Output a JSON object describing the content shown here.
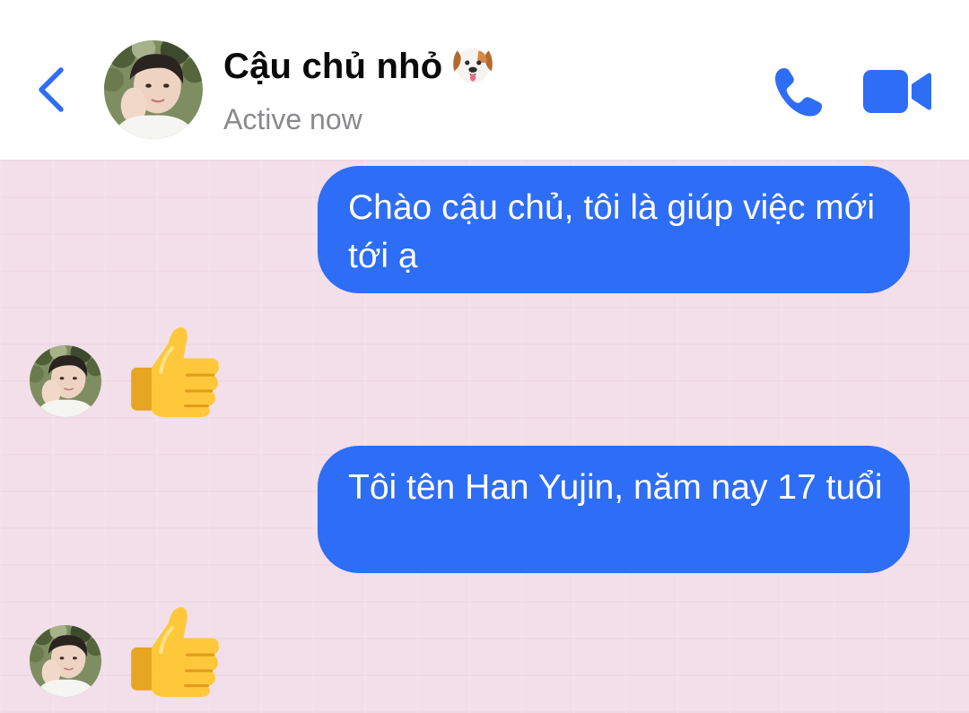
{
  "header": {
    "contact_name": "Cậu chủ nhỏ",
    "name_emoji": "dog-face-emoji",
    "status": "Active now",
    "icons": {
      "back": "chevron-left-icon",
      "call": "phone-icon",
      "video": "video-camera-icon"
    },
    "accent_color": "#2e6df6"
  },
  "messages": [
    {
      "sender": "me",
      "type": "text",
      "text": "Chào cậu chủ, tôi là giúp việc mới tới ạ"
    },
    {
      "sender": "contact",
      "type": "emoji",
      "emoji": "thumbs-up-emoji"
    },
    {
      "sender": "me",
      "type": "text",
      "text": "Tôi tên Han Yujin, năm nay 17 tuổi"
    },
    {
      "sender": "contact",
      "type": "emoji",
      "emoji": "thumbs-up-emoji"
    }
  ],
  "colors": {
    "bubble_outgoing": "#2e6df6",
    "chat_background": "#f2dfe9",
    "header_background": "#ffffff",
    "status_text": "#8a8a8e"
  }
}
